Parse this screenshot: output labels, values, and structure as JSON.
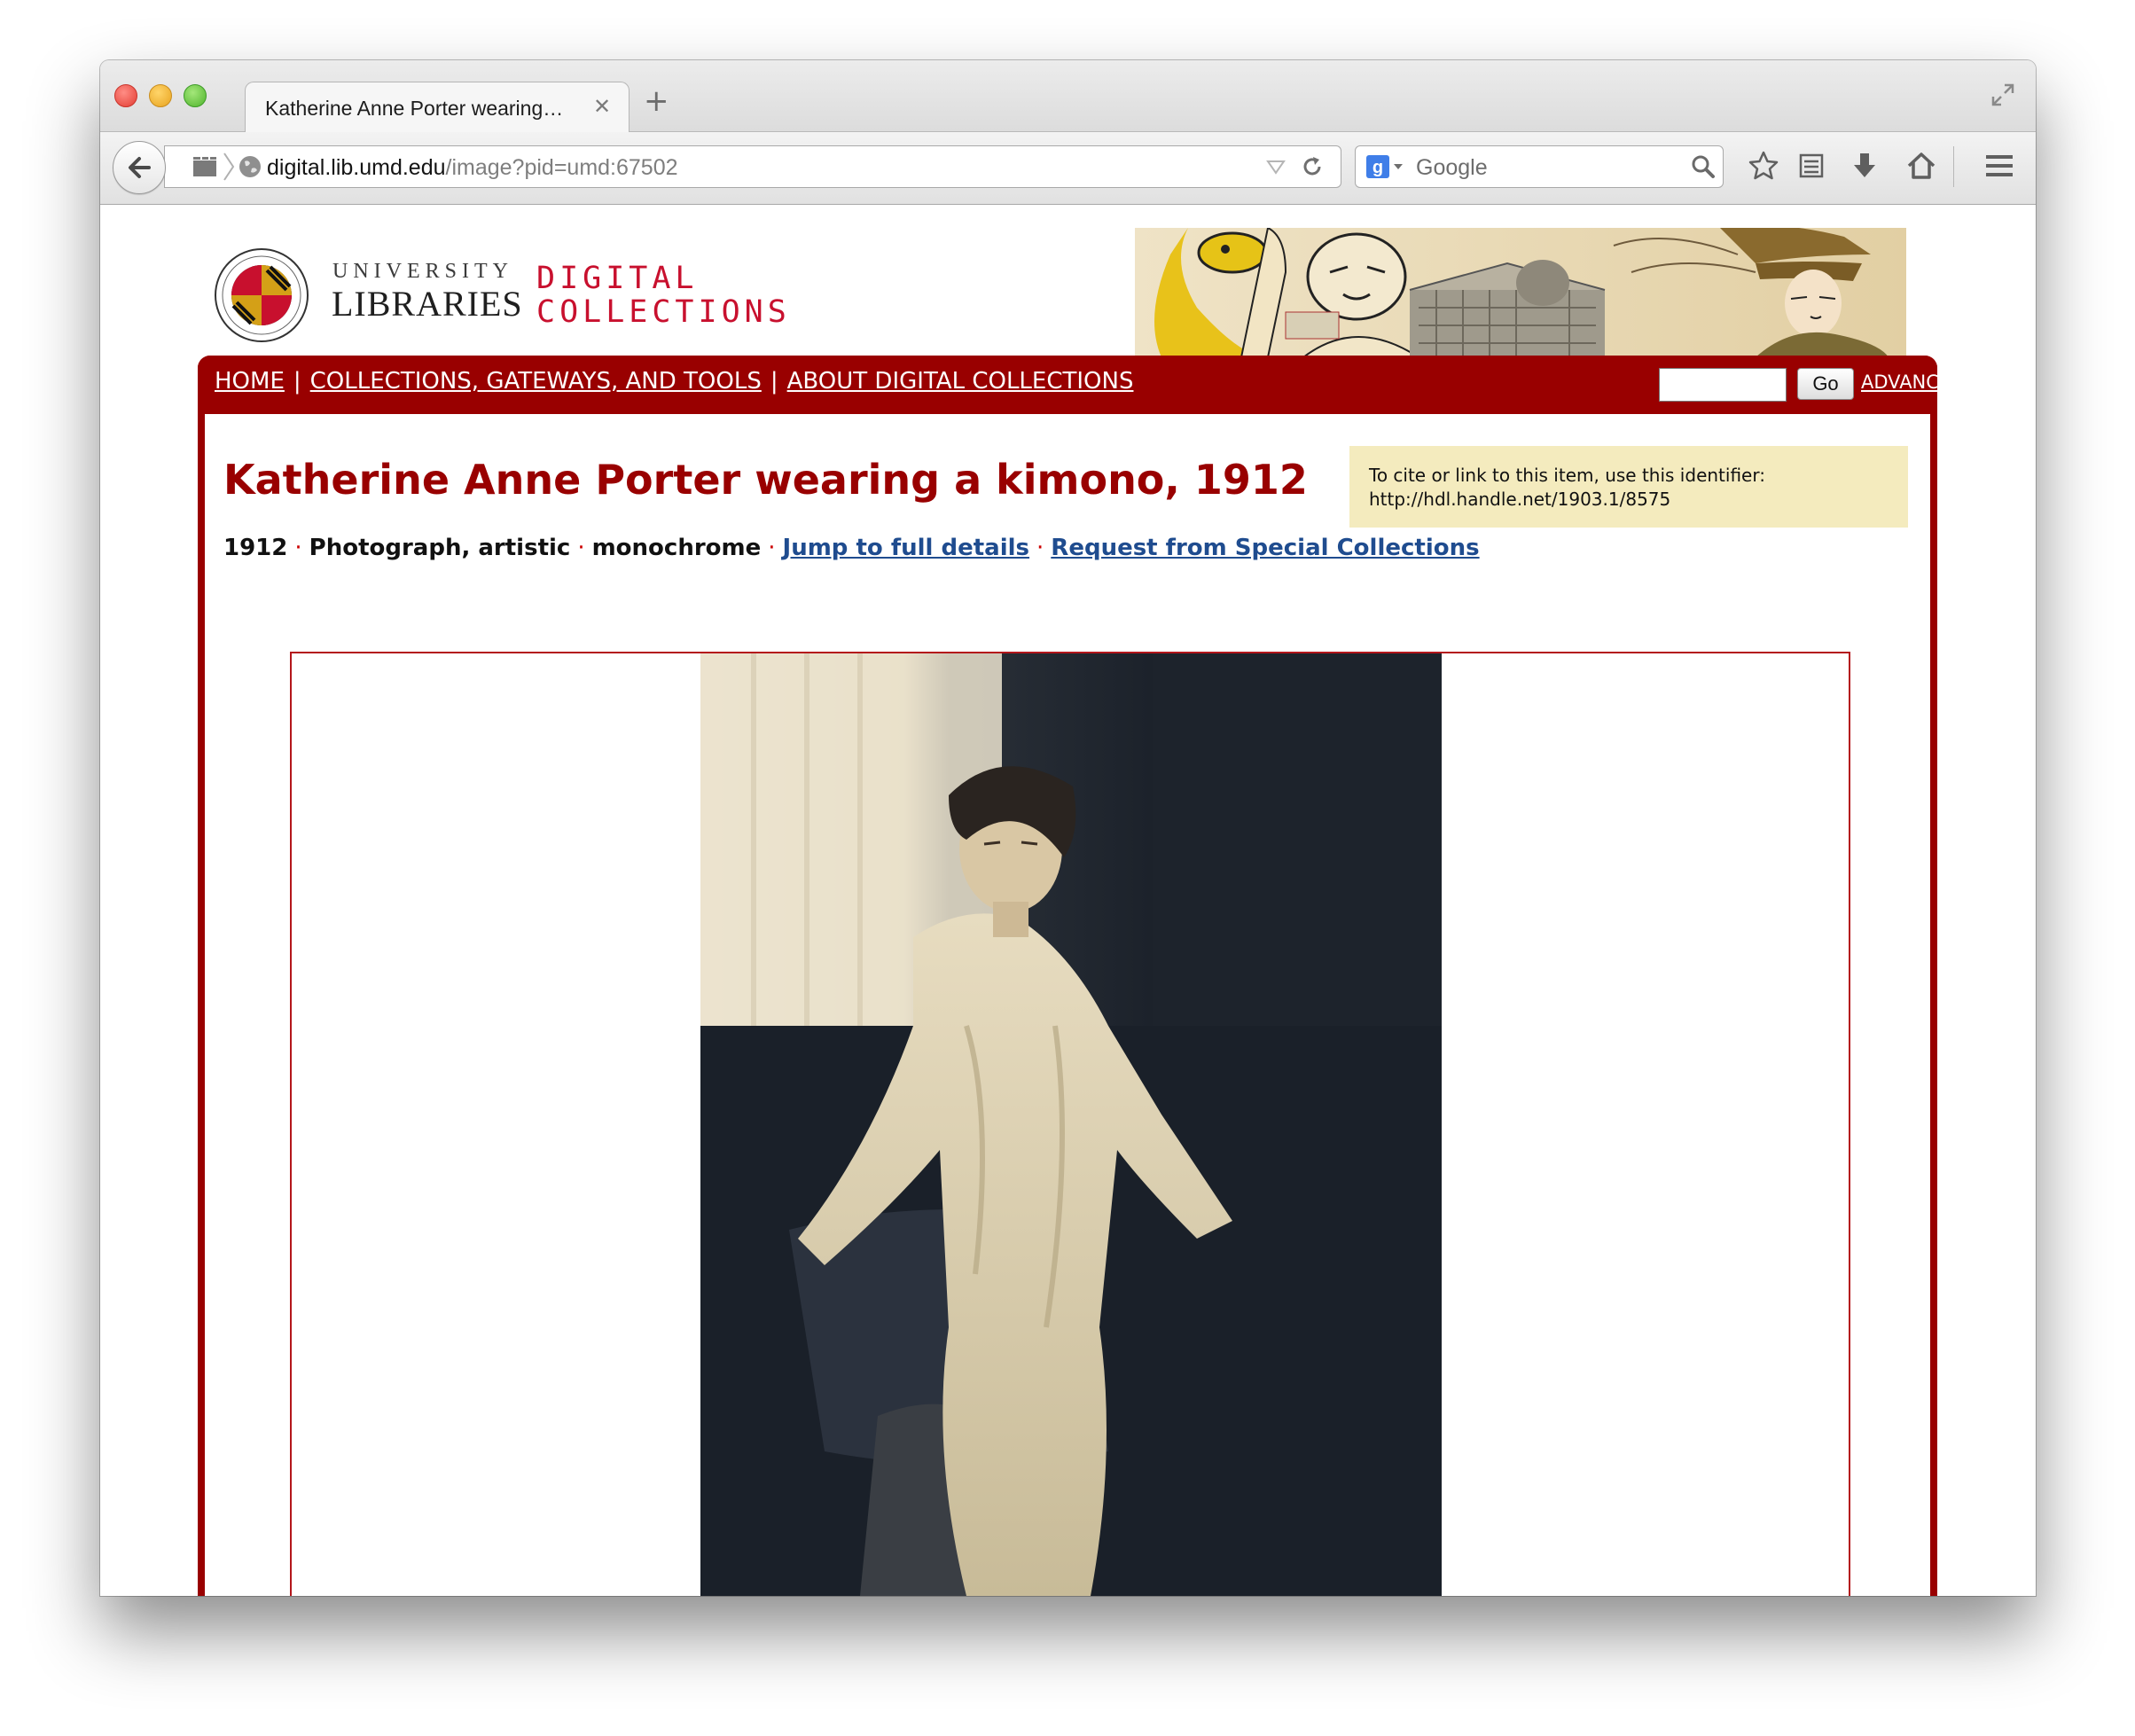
{
  "browser": {
    "tab_title": "Katherine Anne Porter wearing…",
    "tab_close": "✕",
    "new_tab": "+",
    "url_host": "digital.lib.umd.edu",
    "url_path": "/image?pid=umd:67502",
    "search_placeholder": "Google"
  },
  "header": {
    "university": "UNIVERSITY",
    "libraries": "LIBRARIES",
    "digital": "DIGITAL",
    "collections": "COLLECTIONS"
  },
  "menu": {
    "items": [
      "HOME",
      "COLLECTIONS, GATEWAYS, AND TOOLS",
      "ABOUT DIGITAL COLLECTIONS"
    ],
    "separator": "|",
    "go_label": "Go",
    "advanced_search": "ADVANCED SEARCH"
  },
  "item": {
    "title": "Katherine Anne Porter wearing a kimono, 1912",
    "date": "1912",
    "type": "Photograph, artistic",
    "color": "monochrome",
    "jump_link": "Jump to full details",
    "request_link": "Request from Special Collections",
    "bullet": "·"
  },
  "cite": {
    "line1": "To cite or link to this item, use this identifier:",
    "line2": "http://hdl.handle.net/1903.1/8575"
  },
  "viewer": {
    "controls": [
      "zoom-in-icon",
      "zoom-out-icon",
      "pan-left-icon",
      "pan-up-icon",
      "pan-down-icon",
      "pan-right-icon",
      "reset-icon"
    ]
  },
  "colors": {
    "brand_red": "#990000",
    "title_red": "#990000",
    "link_blue": "#1f4c8f",
    "cite_bg": "#f4ebbe"
  }
}
